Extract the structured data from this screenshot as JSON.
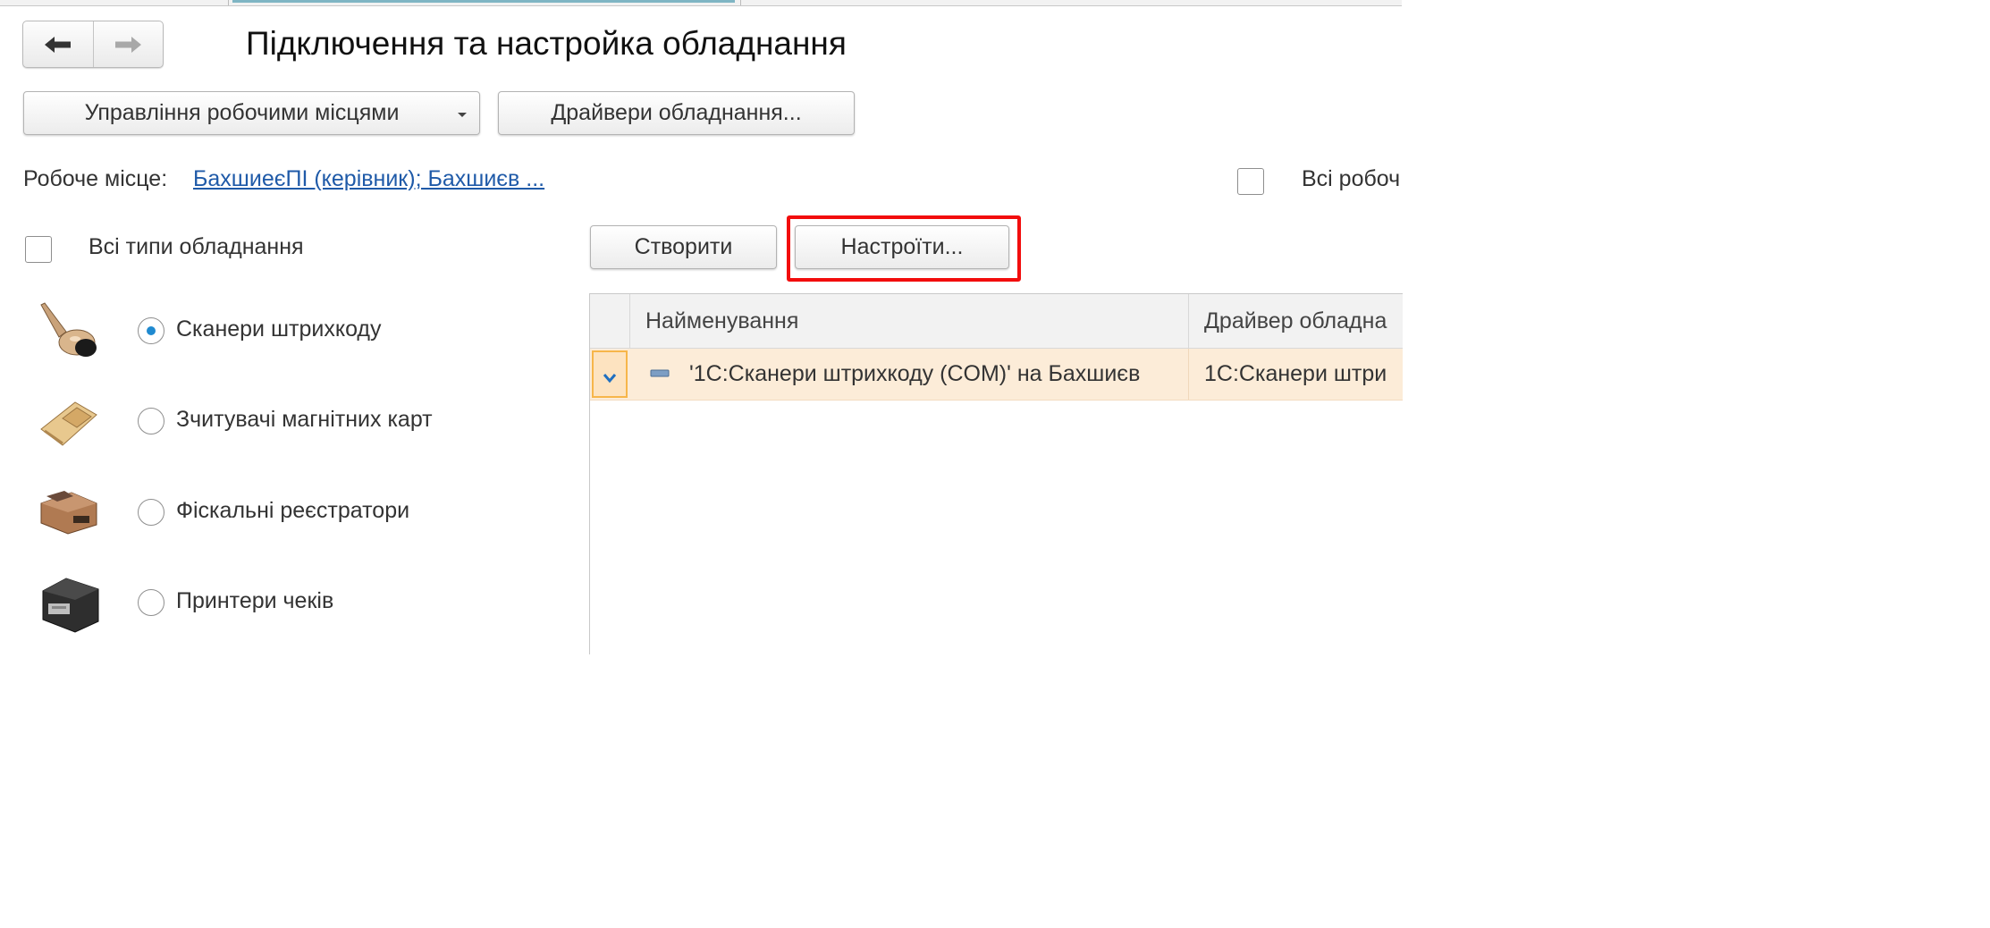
{
  "window": {
    "title": "Підключення та настройка обладнання"
  },
  "nav": {
    "back_icon": "arrow-left-icon",
    "forward_icon": "arrow-right-icon"
  },
  "toolbar": {
    "workplaces_label": "Управління робочими місцями",
    "drivers_label": "Драйвери обладнання..."
  },
  "workplace": {
    "label": "Робоче місце:",
    "value": "БахшиеєПІ (керівник); Бахшиєв ...",
    "all_label": "Всі робоч"
  },
  "filters": {
    "all_types_label": "Всі типи обладнання",
    "device_types": [
      {
        "label": "Сканери штрихкоду",
        "icon": "barcode-scanner-icon",
        "selected": true
      },
      {
        "label": "Зчитувачі магнітних карт",
        "icon": "magnetic-card-reader-icon",
        "selected": false
      },
      {
        "label": "Фіскальні реєстратори",
        "icon": "fiscal-registrar-icon",
        "selected": false
      },
      {
        "label": "Принтери чеків",
        "icon": "receipt-printer-icon",
        "selected": false
      }
    ]
  },
  "actions": {
    "create_label": "Створити",
    "configure_label": "Настроїти..."
  },
  "colors": {
    "highlight": "#f20d0d",
    "selected_row": "#fcecd8",
    "link": "#1f5aa8",
    "radio_dot": "#1f8ad0"
  },
  "table": {
    "columns": [
      "Найменування",
      "Драйвер обладна"
    ],
    "rows": [
      {
        "name": "'1С:Сканери штрихкоду (COM)' на Бахшиєв",
        "driver": "1С:Сканери штри",
        "icon": "device-item-icon"
      }
    ]
  }
}
